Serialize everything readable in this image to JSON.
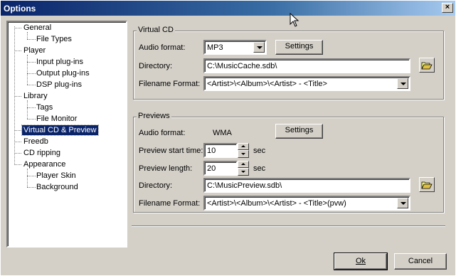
{
  "window": {
    "title": "Options",
    "close_glyph": "×"
  },
  "tree": {
    "items": [
      {
        "label": "General",
        "level": 0
      },
      {
        "label": "File Types",
        "level": 1
      },
      {
        "label": "Player",
        "level": 0
      },
      {
        "label": "Input plug-ins",
        "level": 1
      },
      {
        "label": "Output plug-ins",
        "level": 1
      },
      {
        "label": "DSP plug-ins",
        "level": 1
      },
      {
        "label": "Library",
        "level": 0
      },
      {
        "label": "Tags",
        "level": 1
      },
      {
        "label": "File Monitor",
        "level": 1
      },
      {
        "label": "Virtual CD & Preview",
        "level": 0,
        "selected": true
      },
      {
        "label": "Freedb",
        "level": 0
      },
      {
        "label": "CD ripping",
        "level": 0
      },
      {
        "label": "Appearance",
        "level": 0
      },
      {
        "label": "Player Skin",
        "level": 1
      },
      {
        "label": "Background",
        "level": 1
      }
    ]
  },
  "virtual_cd": {
    "group_label": "Virtual CD",
    "audio_format_label": "Audio format:",
    "audio_format_value": "MP3",
    "settings_label": "Settings",
    "directory_label": "Directory:",
    "directory_value": "C:\\MusicCache.sdb\\",
    "filename_format_label": "Filename Format:",
    "filename_format_value": "<Artist>\\<Album>\\<Artist> - <Title>"
  },
  "previews": {
    "group_label": "Previews",
    "audio_format_label": "Audio format:",
    "audio_format_value": "WMA",
    "settings_label": "Settings",
    "start_time_label": "Preview start time:",
    "start_time_value": "10",
    "start_time_unit": "sec",
    "length_label": "Preview length:",
    "length_value": "20",
    "length_unit": "sec",
    "directory_label": "Directory:",
    "directory_value": "C:\\MusicPreview.sdb\\",
    "filename_format_label": "Filename Format:",
    "filename_format_value": "<Artist>\\<Album>\\<Artist> - <Title>(pvw)"
  },
  "footer": {
    "ok_label": "Ok",
    "cancel_label": "Cancel"
  }
}
